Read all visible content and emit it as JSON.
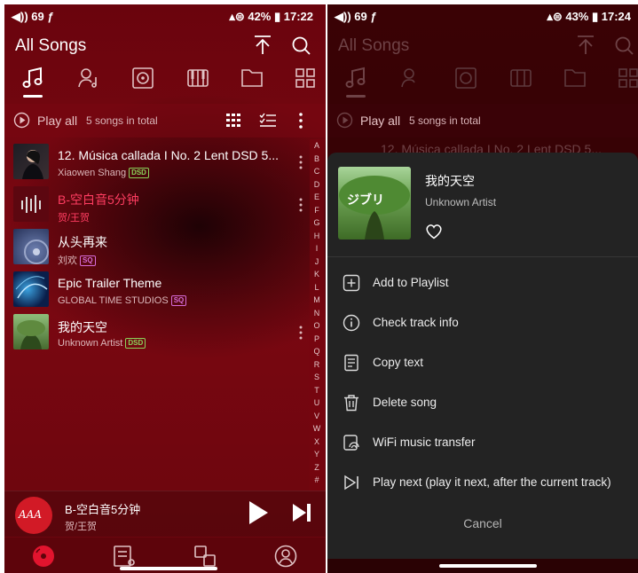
{
  "left": {
    "status": {
      "left": "◀)) 69  ƒ",
      "right": "▴⊜ 42% ▮ 17:22"
    },
    "title": "All Songs",
    "play_all": "Play all",
    "count": "5 songs in total",
    "songs": [
      {
        "title": "12. Música callada I No. 2  Lent DSD 5...",
        "artist": "Xiaowen Shang",
        "badge": "DSD"
      },
      {
        "title": "B-空白音5分钟",
        "artist": "贺/王贺",
        "badge": ""
      },
      {
        "title": "从头再来",
        "artist": "刘欢",
        "badge": "SQ"
      },
      {
        "title": "Epic Trailer Theme",
        "artist": "GLOBAL TIME STUDIOS",
        "badge": "SQ"
      },
      {
        "title": "我的天空",
        "artist": "Unknown Artist",
        "badge": "DSD"
      }
    ],
    "alphabet": [
      "A",
      "B",
      "C",
      "D",
      "E",
      "F",
      "G",
      "H",
      "I",
      "J",
      "K",
      "L",
      "M",
      "N",
      "O",
      "P",
      "Q",
      "R",
      "S",
      "T",
      "U",
      "V",
      "W",
      "X",
      "Y",
      "Z",
      "#"
    ],
    "now_playing": {
      "title": "B-空白音5分钟",
      "artist": "贺/王贺",
      "disc_text": "AAA"
    }
  },
  "right": {
    "status": {
      "left": "◀)) 69  ƒ",
      "right": "▴⊜ 43% ▮ 17:24"
    },
    "title": "All Songs",
    "play_all": "Play all",
    "count": "5 songs in total",
    "bg_song": "12. Música callada I No. 2  Lent DSD 5...",
    "sheet": {
      "title": "我的天空",
      "artist": "Unknown Artist",
      "cover_text": "ジブリ",
      "menu": [
        {
          "label": "Add to Playlist",
          "icon": "add-box-icon"
        },
        {
          "label": "Check track info",
          "icon": "info-icon"
        },
        {
          "label": "Copy text",
          "icon": "document-icon"
        },
        {
          "label": "Delete song",
          "icon": "trash-icon"
        },
        {
          "label": "WiFi music transfer",
          "icon": "wifi-transfer-icon"
        },
        {
          "label": "Play next (play it next, after the current track)",
          "icon": "play-next-icon"
        }
      ],
      "cancel": "Cancel"
    }
  },
  "colors": {
    "accent": "#ff3d61",
    "dsd": "#8bd35a",
    "sq": "#d76bd9",
    "bg": "#7c0812"
  }
}
